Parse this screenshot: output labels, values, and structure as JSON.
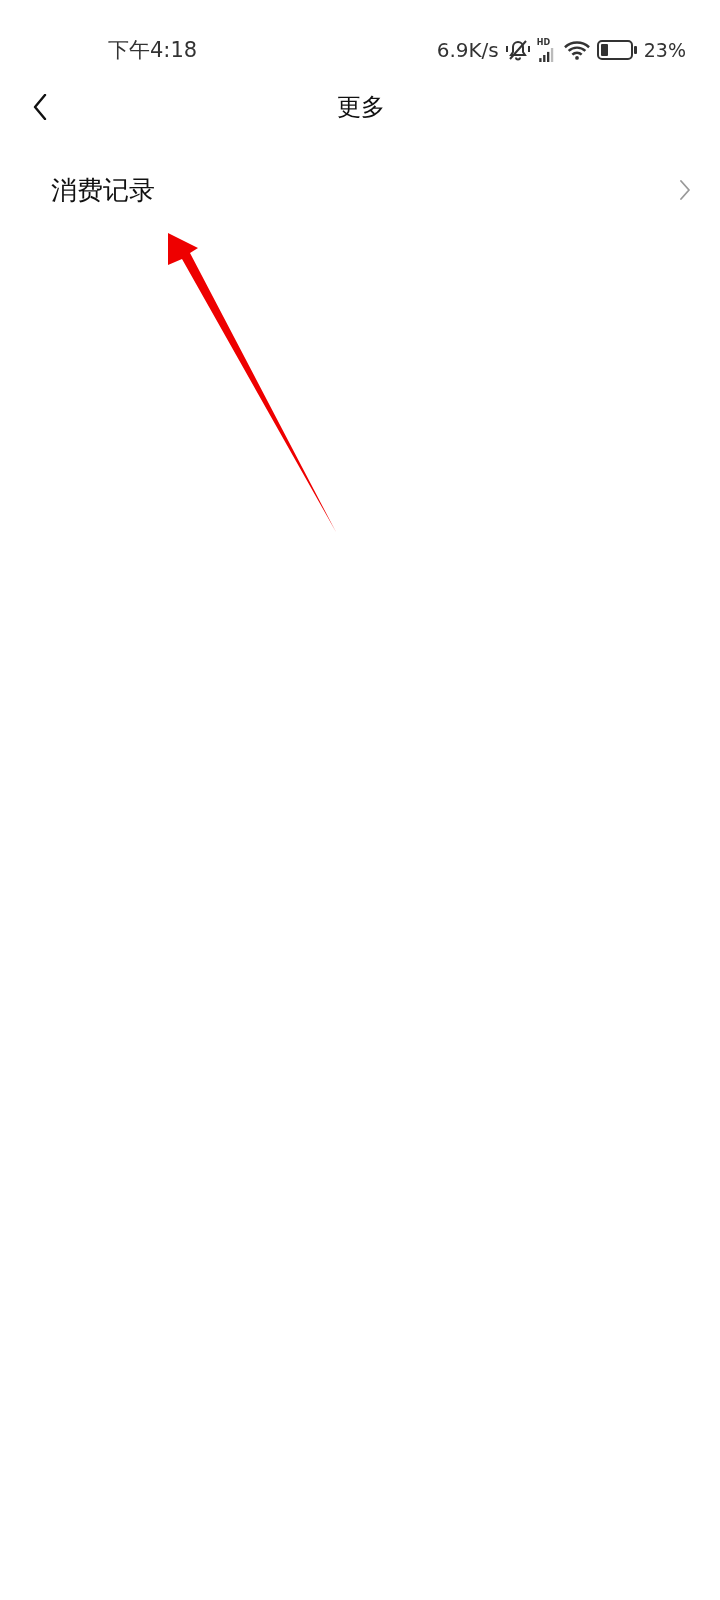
{
  "status_bar": {
    "time": "下午4:18",
    "network_speed": "6.9K/s",
    "signal_badge": "HD",
    "battery": "23%"
  },
  "header": {
    "title": "更多"
  },
  "menu_items": [
    {
      "label": "消费记录"
    }
  ]
}
